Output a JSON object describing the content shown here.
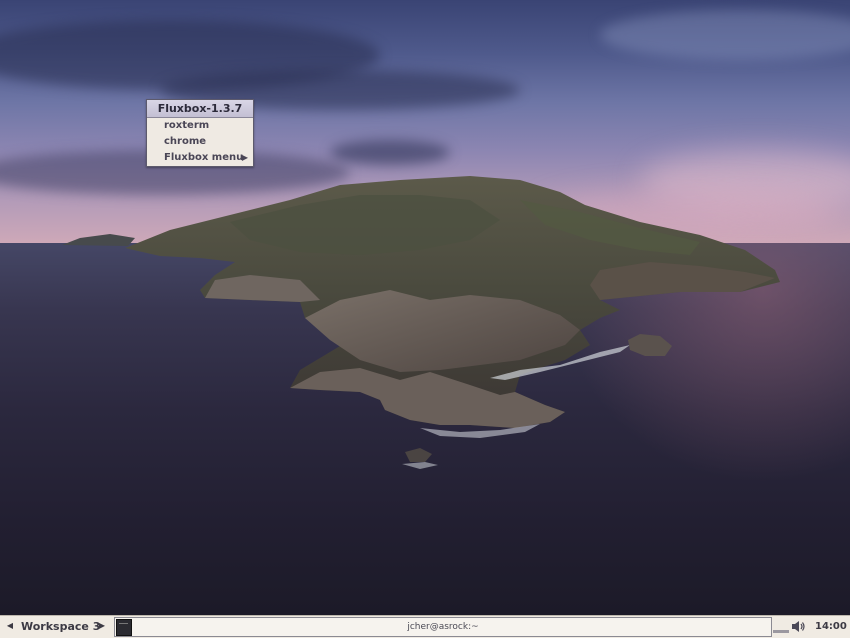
{
  "root_menu": {
    "title": "Fluxbox-1.3.7",
    "items": [
      {
        "label": "roxterm",
        "submenu": false
      },
      {
        "label": "chrome",
        "submenu": false
      },
      {
        "label": "Fluxbox menu",
        "submenu": true
      }
    ],
    "submenu_arrow_icon": "triangle-right-icon"
  },
  "toolbar": {
    "workspace_name": "Workspace 3",
    "prev_icon": "triangle-left-icon",
    "next_icon": "triangle-right-icon",
    "tasks": [
      {
        "title": "jcher@asrock:~",
        "icon": "terminal-icon"
      }
    ],
    "tray_icons": [
      "volume-icon"
    ],
    "clock": "14:00"
  },
  "colors": {
    "menu_bg": "#efeae3",
    "menu_title_bg": "#c9c5d9",
    "toolbar_bg": "#f0ebe3",
    "text": "#3c3a44"
  }
}
